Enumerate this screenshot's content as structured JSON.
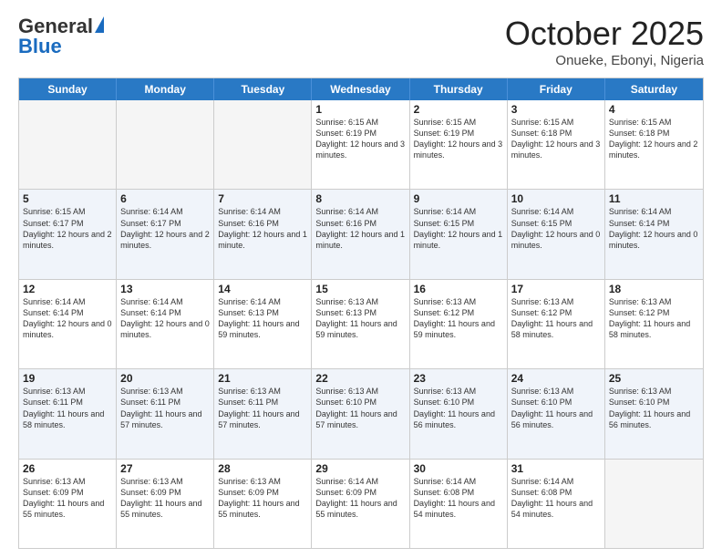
{
  "header": {
    "logo_general": "General",
    "logo_blue": "Blue",
    "month_title": "October 2025",
    "subtitle": "Onueke, Ebonyi, Nigeria"
  },
  "weekdays": [
    "Sunday",
    "Monday",
    "Tuesday",
    "Wednesday",
    "Thursday",
    "Friday",
    "Saturday"
  ],
  "rows": [
    [
      {
        "day": "",
        "info": ""
      },
      {
        "day": "",
        "info": ""
      },
      {
        "day": "",
        "info": ""
      },
      {
        "day": "1",
        "info": "Sunrise: 6:15 AM\nSunset: 6:19 PM\nDaylight: 12 hours\nand 3 minutes."
      },
      {
        "day": "2",
        "info": "Sunrise: 6:15 AM\nSunset: 6:19 PM\nDaylight: 12 hours\nand 3 minutes."
      },
      {
        "day": "3",
        "info": "Sunrise: 6:15 AM\nSunset: 6:18 PM\nDaylight: 12 hours\nand 3 minutes."
      },
      {
        "day": "4",
        "info": "Sunrise: 6:15 AM\nSunset: 6:18 PM\nDaylight: 12 hours\nand 2 minutes."
      }
    ],
    [
      {
        "day": "5",
        "info": "Sunrise: 6:15 AM\nSunset: 6:17 PM\nDaylight: 12 hours\nand 2 minutes."
      },
      {
        "day": "6",
        "info": "Sunrise: 6:14 AM\nSunset: 6:17 PM\nDaylight: 12 hours\nand 2 minutes."
      },
      {
        "day": "7",
        "info": "Sunrise: 6:14 AM\nSunset: 6:16 PM\nDaylight: 12 hours\nand 1 minute."
      },
      {
        "day": "8",
        "info": "Sunrise: 6:14 AM\nSunset: 6:16 PM\nDaylight: 12 hours\nand 1 minute."
      },
      {
        "day": "9",
        "info": "Sunrise: 6:14 AM\nSunset: 6:15 PM\nDaylight: 12 hours\nand 1 minute."
      },
      {
        "day": "10",
        "info": "Sunrise: 6:14 AM\nSunset: 6:15 PM\nDaylight: 12 hours\nand 0 minutes."
      },
      {
        "day": "11",
        "info": "Sunrise: 6:14 AM\nSunset: 6:14 PM\nDaylight: 12 hours\nand 0 minutes."
      }
    ],
    [
      {
        "day": "12",
        "info": "Sunrise: 6:14 AM\nSunset: 6:14 PM\nDaylight: 12 hours\nand 0 minutes."
      },
      {
        "day": "13",
        "info": "Sunrise: 6:14 AM\nSunset: 6:14 PM\nDaylight: 12 hours\nand 0 minutes."
      },
      {
        "day": "14",
        "info": "Sunrise: 6:14 AM\nSunset: 6:13 PM\nDaylight: 11 hours\nand 59 minutes."
      },
      {
        "day": "15",
        "info": "Sunrise: 6:13 AM\nSunset: 6:13 PM\nDaylight: 11 hours\nand 59 minutes."
      },
      {
        "day": "16",
        "info": "Sunrise: 6:13 AM\nSunset: 6:12 PM\nDaylight: 11 hours\nand 59 minutes."
      },
      {
        "day": "17",
        "info": "Sunrise: 6:13 AM\nSunset: 6:12 PM\nDaylight: 11 hours\nand 58 minutes."
      },
      {
        "day": "18",
        "info": "Sunrise: 6:13 AM\nSunset: 6:12 PM\nDaylight: 11 hours\nand 58 minutes."
      }
    ],
    [
      {
        "day": "19",
        "info": "Sunrise: 6:13 AM\nSunset: 6:11 PM\nDaylight: 11 hours\nand 58 minutes."
      },
      {
        "day": "20",
        "info": "Sunrise: 6:13 AM\nSunset: 6:11 PM\nDaylight: 11 hours\nand 57 minutes."
      },
      {
        "day": "21",
        "info": "Sunrise: 6:13 AM\nSunset: 6:11 PM\nDaylight: 11 hours\nand 57 minutes."
      },
      {
        "day": "22",
        "info": "Sunrise: 6:13 AM\nSunset: 6:10 PM\nDaylight: 11 hours\nand 57 minutes."
      },
      {
        "day": "23",
        "info": "Sunrise: 6:13 AM\nSunset: 6:10 PM\nDaylight: 11 hours\nand 56 minutes."
      },
      {
        "day": "24",
        "info": "Sunrise: 6:13 AM\nSunset: 6:10 PM\nDaylight: 11 hours\nand 56 minutes."
      },
      {
        "day": "25",
        "info": "Sunrise: 6:13 AM\nSunset: 6:10 PM\nDaylight: 11 hours\nand 56 minutes."
      }
    ],
    [
      {
        "day": "26",
        "info": "Sunrise: 6:13 AM\nSunset: 6:09 PM\nDaylight: 11 hours\nand 55 minutes."
      },
      {
        "day": "27",
        "info": "Sunrise: 6:13 AM\nSunset: 6:09 PM\nDaylight: 11 hours\nand 55 minutes."
      },
      {
        "day": "28",
        "info": "Sunrise: 6:13 AM\nSunset: 6:09 PM\nDaylight: 11 hours\nand 55 minutes."
      },
      {
        "day": "29",
        "info": "Sunrise: 6:14 AM\nSunset: 6:09 PM\nDaylight: 11 hours\nand 55 minutes."
      },
      {
        "day": "30",
        "info": "Sunrise: 6:14 AM\nSunset: 6:08 PM\nDaylight: 11 hours\nand 54 minutes."
      },
      {
        "day": "31",
        "info": "Sunrise: 6:14 AM\nSunset: 6:08 PM\nDaylight: 11 hours\nand 54 minutes."
      },
      {
        "day": "",
        "info": ""
      }
    ]
  ],
  "alt_rows": [
    1,
    3
  ]
}
